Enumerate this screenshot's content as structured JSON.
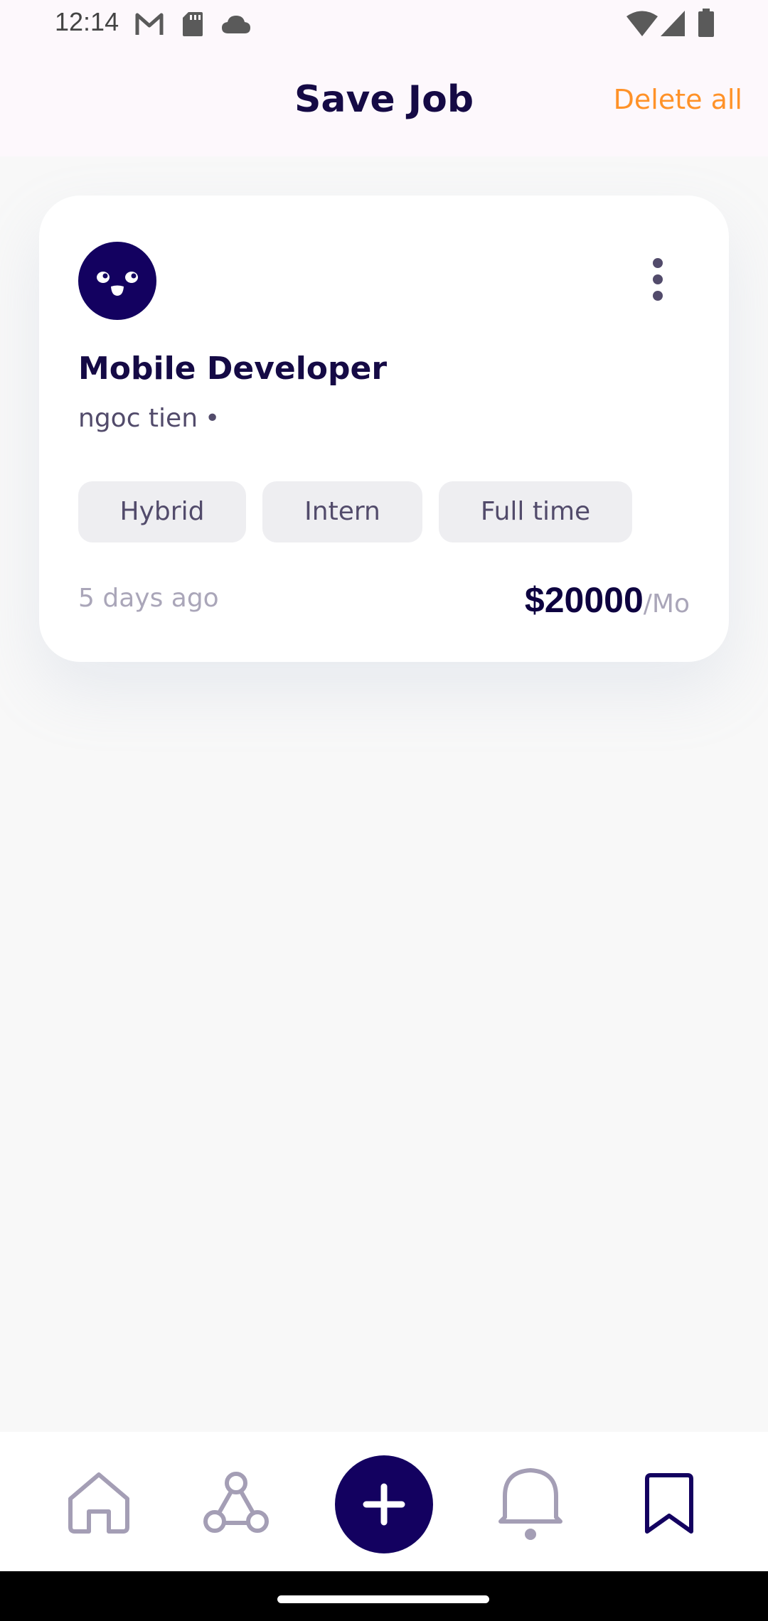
{
  "status_bar": {
    "time": "12:14",
    "left_icons": [
      "gmail-icon",
      "sd-card-icon",
      "cloud-icon"
    ],
    "right_icons": [
      "wifi-icon",
      "signal-icon",
      "battery-icon"
    ]
  },
  "header": {
    "title": "Save Job",
    "delete_all_label": "Delete all"
  },
  "job_card": {
    "logo_icon": "company-logo-icon",
    "title": "Mobile Developer",
    "company": "ngoc tien",
    "company_separator": "•",
    "tags": [
      "Hybrid",
      "Intern",
      "Full time"
    ],
    "posted": "5 days ago",
    "salary_amount": "$20000",
    "salary_period": "/Mo"
  },
  "bottom_nav": {
    "items": [
      "home-icon",
      "connections-icon",
      "add-icon",
      "notifications-icon",
      "saved-icon"
    ],
    "active": "saved-icon"
  },
  "colors": {
    "primary": "#130160",
    "title_text": "#150A45",
    "accent": "#FF9228",
    "muted_text": "#AAA6B9",
    "body_text": "#524B6B",
    "tag_background": "#EEEEF1",
    "inactive_icon": "#A49EB5"
  }
}
